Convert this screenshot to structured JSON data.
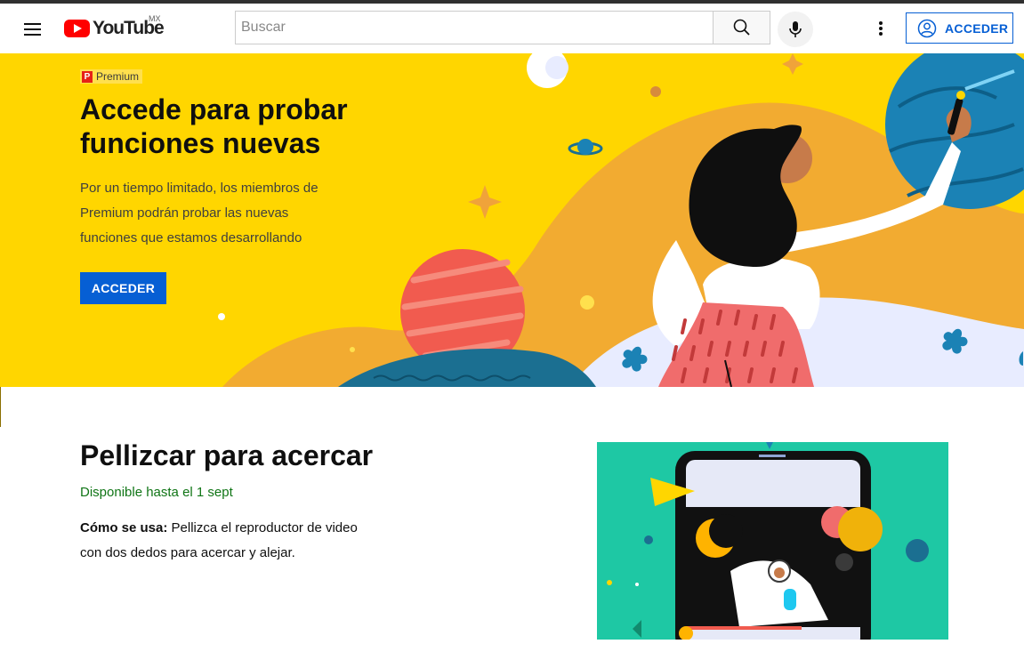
{
  "header": {
    "logo_text": "YouTube",
    "country_code": "MX",
    "search_placeholder": "Buscar",
    "signin_label": "ACCEDER"
  },
  "hero": {
    "badge": "Premium",
    "badge_letter": "P",
    "title": "Accede para probar funciones nuevas",
    "description": "Por un tiempo limitado, los miembros de Premium podrán probar las nuevas funciones que estamos desarrollando",
    "button_label": "ACCEDER",
    "background_color": "#ffd600"
  },
  "feature": {
    "title": "Pellizcar para acercar",
    "availability": "Disponible hasta el 1 sept",
    "howto_label": "Cómo se usa:",
    "howto_text": " Pellizca el reproductor de video con dos dedos para acercar y alejar."
  },
  "colors": {
    "brand_red": "#ff0000",
    "link_blue": "#065fd4",
    "available_green": "#107516",
    "feature_bg": "#1ec8a4"
  },
  "icons": [
    "menu-icon",
    "youtube-logo-icon",
    "search-icon",
    "microphone-icon",
    "more-vert-icon",
    "account-circle-icon"
  ]
}
